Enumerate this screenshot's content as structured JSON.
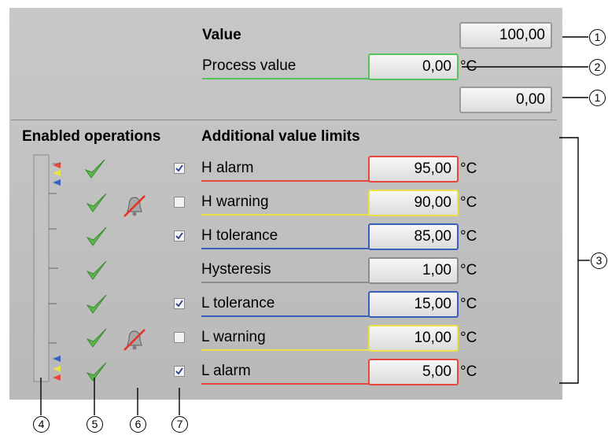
{
  "value_section": {
    "title": "Value",
    "value_top": "100,00",
    "process_label": "Process value",
    "process_value": "0,00",
    "process_unit": "°C",
    "value_bottom": "0,00"
  },
  "headers": {
    "enabled_operations": "Enabled operations",
    "additional_limits": "Additional value limits"
  },
  "limits": [
    {
      "label": "H alarm",
      "value": "95,00",
      "unit": "°C",
      "checked": true,
      "has_checkbox": true,
      "color": "#e8453c"
    },
    {
      "label": "H warning",
      "value": "90,00",
      "unit": "°C",
      "checked": false,
      "has_checkbox": true,
      "color": "#ede14a"
    },
    {
      "label": "H tolerance",
      "value": "85,00",
      "unit": "°C",
      "checked": true,
      "has_checkbox": true,
      "color": "#3a5fb8"
    },
    {
      "label": "Hysteresis",
      "value": "1,00",
      "unit": "°C",
      "checked": false,
      "has_checkbox": false,
      "color": "#8c8c8c"
    },
    {
      "label": "L tolerance",
      "value": "15,00",
      "unit": "°C",
      "checked": true,
      "has_checkbox": true,
      "color": "#3a5fb8"
    },
    {
      "label": "L warning",
      "value": "10,00",
      "unit": "°C",
      "checked": false,
      "has_checkbox": true,
      "color": "#ede14a"
    },
    {
      "label": "L alarm",
      "value": "5,00",
      "unit": "°C",
      "checked": true,
      "has_checkbox": true,
      "color": "#e8453c"
    }
  ],
  "callouts": [
    "1",
    "2",
    "1",
    "3",
    "4",
    "5",
    "6",
    "7"
  ],
  "colors": {
    "process_border": "#56c25a",
    "panel": "#bebebe",
    "check_green": "#5bb84a"
  }
}
